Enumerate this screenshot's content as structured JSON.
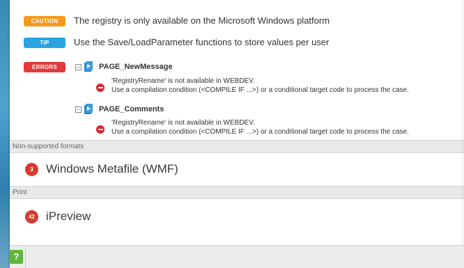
{
  "notices": {
    "caution": {
      "badge": "CAUTION",
      "text": "The registry is only available on the Microsoft Windows platform"
    },
    "tip": {
      "badge": "TIP",
      "text": "Use the Save/LoadParameter functions to store values per user"
    },
    "errors": {
      "badge": "ERRORS"
    }
  },
  "error_groups": [
    {
      "page": "PAGE_NewMessage",
      "line1": "'RegistryRename' is not available in WEBDEV.",
      "line2": "Use a compilation condition (<COMPILE IF ...>) or a conditional target code to process the case."
    },
    {
      "page": "PAGE_Comments",
      "line1": "'RegistryRename' is not available in WEBDEV.",
      "line2": "Use a compilation condition (<COMPILE IF ...>) or a conditional target code to process the case."
    }
  ],
  "sections": [
    {
      "header": "Non-supported formats",
      "count": "3",
      "label": "Windows Metafile (WMF)"
    },
    {
      "header": "Print",
      "count": "42",
      "label": "iPreview"
    }
  ],
  "footer": {
    "help": "?"
  },
  "colors": {
    "caution": "#f39a1e",
    "tip": "#2aa4e0",
    "errors": "#e23a3a",
    "help": "#5fb63a"
  }
}
